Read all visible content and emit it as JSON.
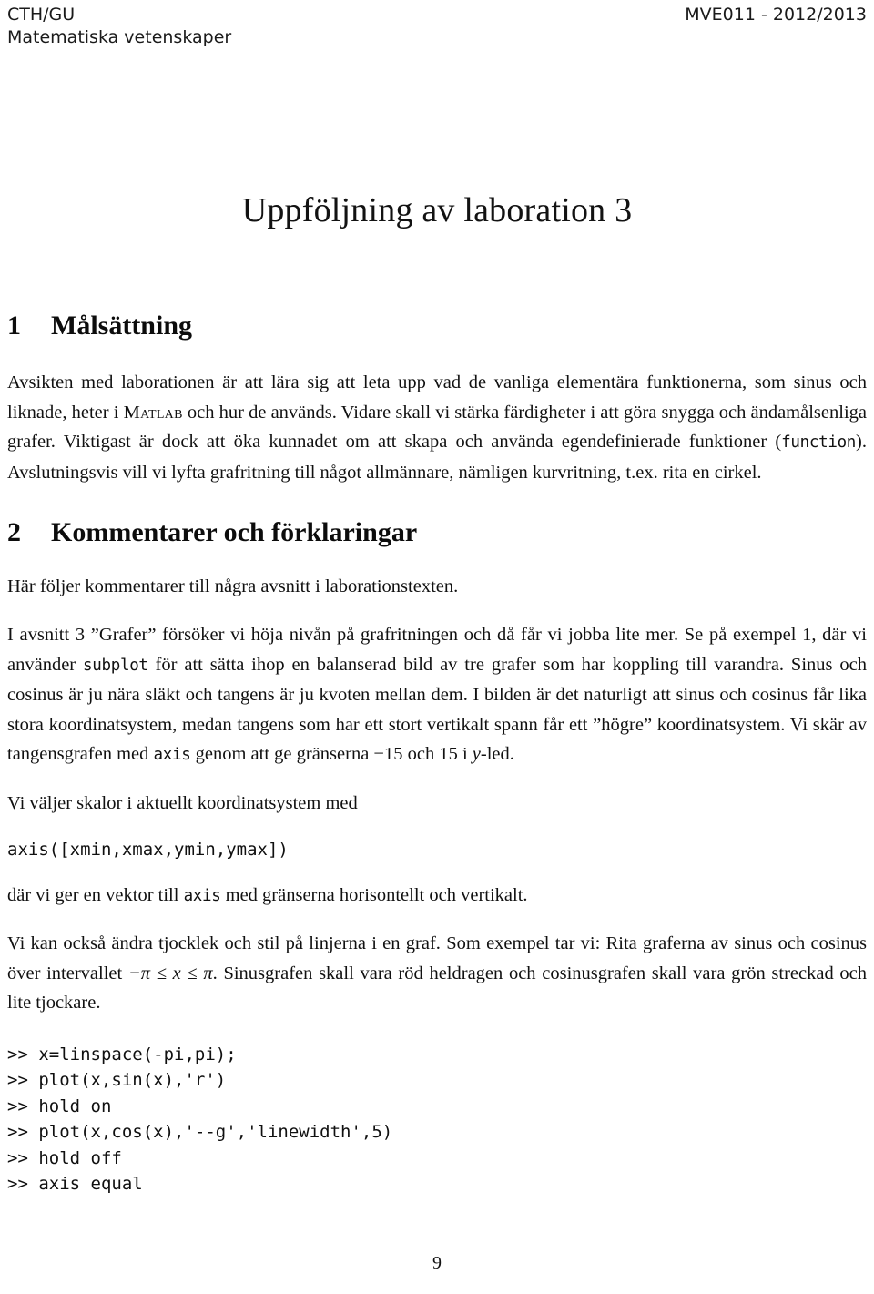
{
  "header": {
    "left_line1": "CTH/GU",
    "left_line2": "Matematiska vetenskaper",
    "right": "MVE011 - 2012/2013"
  },
  "title": "Uppföljning av laboration 3",
  "sections": [
    {
      "number": "1",
      "heading": "Målsättning",
      "paragraphs": [
        {
          "parts": [
            {
              "type": "text",
              "text": "Avsikten med laborationen är att lära sig att leta upp vad de vanliga elementära funktionerna, som sinus och liknade, heter i "
            },
            {
              "type": "smallcaps",
              "text": "Matlab"
            },
            {
              "type": "text",
              "text": " och hur de används. Vidare skall vi stärka färdigheter i att göra snygga och ändamålsenliga grafer. Viktigast är dock att öka kunnadet om att skapa och använda egendefinierade funktioner ("
            },
            {
              "type": "tt",
              "text": "function"
            },
            {
              "type": "text",
              "text": "). Avslutningsvis vill vi lyfta grafritning till något allmännare, nämligen kurvritning, t.ex. rita en cirkel."
            }
          ]
        }
      ]
    },
    {
      "number": "2",
      "heading": "Kommentarer och förklaringar",
      "paragraphs": [
        {
          "parts": [
            {
              "type": "text",
              "text": "Här följer kommentarer till några avsnitt i laborationstexten."
            }
          ]
        },
        {
          "parts": [
            {
              "type": "text",
              "text": "I avsnitt 3 ”Grafer” försöker vi höja nivån på grafritningen och då får vi jobba lite mer. Se på exempel 1, där vi använder "
            },
            {
              "type": "tt",
              "text": "subplot"
            },
            {
              "type": "text",
              "text": " för att sätta ihop en balanserad bild av tre grafer som har koppling till varandra. Sinus och cosinus är ju nära släkt och tangens är ju kvoten mellan dem. I bilden är det naturligt att sinus och cosinus får lika stora koordinatsystem, medan tangens som har ett stort vertikalt spann får ett ”högre” koordinatsystem. Vi skär av tangensgrafen med "
            },
            {
              "type": "tt",
              "text": "axis"
            },
            {
              "type": "text",
              "text": " genom att ge gränserna −15 och 15 i "
            },
            {
              "type": "math",
              "text": "y"
            },
            {
              "type": "text",
              "text": "-led."
            }
          ]
        },
        {
          "parts": [
            {
              "type": "text",
              "text": "Vi väljer skalor i aktuellt koordinatsystem med"
            }
          ]
        }
      ]
    }
  ],
  "code_inline_axis": "axis([xmin,xmax,ymin,ymax])",
  "paragraph_after_axis": {
    "parts": [
      {
        "type": "text",
        "text": "där vi ger en vektor till "
      },
      {
        "type": "tt",
        "text": "axis"
      },
      {
        "type": "text",
        "text": " med gränserna horisontellt och vertikalt."
      }
    ]
  },
  "paragraph_linjer": {
    "parts": [
      {
        "type": "text",
        "text": "Vi kan också ändra tjocklek och stil på linjerna i en graf. Som exempel tar vi: Rita graferna av sinus och cosinus över intervallet "
      },
      {
        "type": "math",
        "text": "−π ≤ x ≤ π"
      },
      {
        "type": "text",
        "text": ". Sinusgrafen skall vara röd heldragen och cosinusgrafen skall vara grön streckad och lite tjockare."
      }
    ]
  },
  "code_block_lines": [
    ">> x=linspace(-pi,pi);",
    ">> plot(x,sin(x),'r')",
    ">> hold on",
    ">> plot(x,cos(x),'--g','linewidth',5)",
    ">> hold off",
    ">> axis equal"
  ],
  "folio": "9"
}
